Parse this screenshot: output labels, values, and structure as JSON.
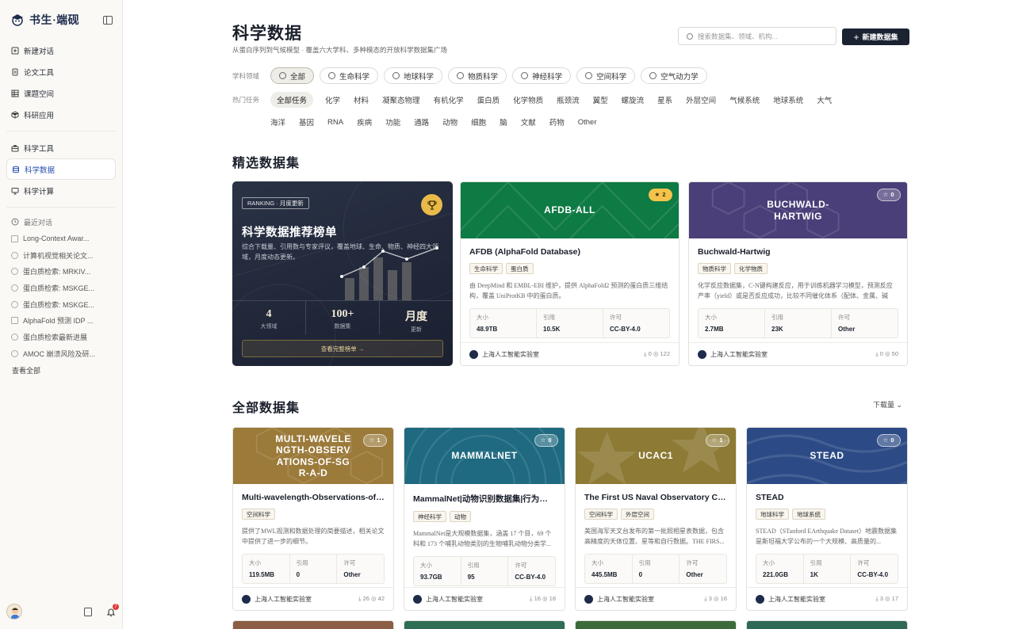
{
  "brand": {
    "name": "书生·端砚"
  },
  "sidebar": {
    "main_items": [
      {
        "label": "新建对话",
        "icon": "plus-square-icon"
      },
      {
        "label": "论文工具",
        "icon": "document-icon"
      },
      {
        "label": "课题空间",
        "icon": "grid-icon"
      },
      {
        "label": "科研应用",
        "icon": "cube-icon"
      }
    ],
    "tool_items": [
      {
        "label": "科学工具",
        "icon": "toolbox-icon"
      },
      {
        "label": "科学数据",
        "icon": "database-icon",
        "active": true
      },
      {
        "label": "科学计算",
        "icon": "monitor-icon"
      }
    ],
    "recent_heading": "最近对话",
    "recent": [
      {
        "label": "Long-Context Awar...",
        "icon": "doc"
      },
      {
        "label": "计算机视觉相关论文...",
        "icon": "cube"
      },
      {
        "label": "蛋白质检索: MRKIV...",
        "icon": "cube"
      },
      {
        "label": "蛋白质检索: MSKGE...",
        "icon": "cube"
      },
      {
        "label": "蛋白质检索: MSKGE...",
        "icon": "cube"
      },
      {
        "label": "AlphaFold 预测 IDP ...",
        "icon": "doc"
      },
      {
        "label": "蛋白质检索最新进展",
        "icon": "cube"
      },
      {
        "label": "AMOC 崩溃风险及研...",
        "icon": "cube"
      }
    ],
    "view_all": "查看全部",
    "notif_count": "7"
  },
  "header": {
    "title": "科学数据",
    "subtitle": "从蛋白序列到气候模型 · 覆盖六大学科、多种模态的开放科学数据集广场",
    "search_placeholder": "搜索数据集、领域、机构...",
    "new_button": "新建数据集"
  },
  "filters": {
    "domain_label": "学科领域",
    "domains": [
      {
        "label": "全部",
        "active": true
      },
      {
        "label": "生命科学"
      },
      {
        "label": "地球科学"
      },
      {
        "label": "物质科学"
      },
      {
        "label": "神经科学"
      },
      {
        "label": "空间科学"
      },
      {
        "label": "空气动力学"
      }
    ],
    "task_label": "热门任务",
    "tasks_row1": [
      "全部任务",
      "化学",
      "材料",
      "凝聚态物理",
      "有机化学",
      "蛋白质",
      "化学物质",
      "瓶颈流",
      "翼型",
      "螺旋流",
      "星系",
      "外层空间",
      "气候系统",
      "地球系统",
      "大气"
    ],
    "tasks_row2": [
      "海洋",
      "基因",
      "RNA",
      "疾病",
      "功能",
      "通路",
      "动物",
      "细胞",
      "脑",
      "文献",
      "药物",
      "Other"
    ]
  },
  "featured": {
    "heading": "精选数据集",
    "ranking": {
      "badge": "RANKING · 月度更新",
      "title": "科学数据推荐榜单",
      "desc": "综合下载量、引用数与专家评议，覆盖地球、生命、物质、神经四大领域，月度动态更新。",
      "stats": [
        {
          "value": "4",
          "label": "大领域"
        },
        {
          "value": "100+",
          "label": "数据集"
        },
        {
          "value": "月度",
          "label": "更新"
        }
      ],
      "button": "查看完整榜单 →"
    },
    "cards": [
      {
        "banner": "AFDB-ALL",
        "color": "#0e7a44",
        "star": "★ 2",
        "gold": true,
        "title": "AFDB (AlphaFold Database)",
        "tags": [
          "生命科学",
          "蛋白质"
        ],
        "desc": "由 DeepMind 和 EMBL-EBI 维护，提供 AlphaFold2 预测的蛋白质三维结构，覆盖 UniProtKB 中的蛋白质。",
        "size_label": "大小",
        "size": "48.9TB",
        "cite_label": "引用",
        "cite": "10.5K",
        "lic_label": "许可",
        "lic": "CC-BY-4.0",
        "org": "上海人工智能实验室",
        "downloads": "0",
        "views": "122"
      },
      {
        "banner": "BUCHWALD-HARTWIG",
        "color": "#4a3f78",
        "star": "☆ 0",
        "gold": false,
        "title": "Buchwald-Hartwig",
        "tags": [
          "物质科学",
          "化学物质"
        ],
        "desc": "化学反应数据集，C-N键构建反应，用于训练机器学习模型，预测反应产率（yield）或是否反应成功，比较不同催化体系（配体、金属、碱等...",
        "size_label": "大小",
        "size": "2.7MB",
        "cite_label": "引用",
        "cite": "23K",
        "lic_label": "许可",
        "lic": "Other",
        "org": "上海人工智能实验室",
        "downloads": "0",
        "views": "50"
      }
    ]
  },
  "all": {
    "heading": "全部数据集",
    "sort": "下载量 ⌄",
    "cards": [
      {
        "banner": "MULTI-WAVELENGTH-OBSERVATIONS-OF-SGR-A-D",
        "banner_lines": "MULTI-WAVELE NGTH-OBSERV ATIONS-OF-SG R-A-D",
        "color": "#9b7a3a",
        "star": "☆ 1",
        "title": "Multi-wavelength-Observations-of-Sgr-A-D",
        "tags": [
          "空间科学"
        ],
        "desc": "提供了MWL观测和数据处理的简要描述，相关论文中提供了进一步的细节。",
        "size_label": "大小",
        "size": "119.5MB",
        "cite_label": "引用",
        "cite": "0",
        "lic_label": "许可",
        "lic": "Other",
        "org": "上海人工智能实验室",
        "downloads": "26",
        "views": "42"
      },
      {
        "banner": "MAMMALNET",
        "color": "#1f6a80",
        "star": "☆ 0",
        "title": "MammalNet|动物识别数据集|行为识别",
        "tags": [
          "神经科学",
          "动物"
        ],
        "desc": "MammalNet是大规模数据集，涵盖 17 个目，69 个科和 173 个哺乳动物类别的生物哺乳动物分类学...",
        "size_label": "大小",
        "size": "93.7GB",
        "cite_label": "引用",
        "cite": "95",
        "lic_label": "许可",
        "lic": "CC-BY-4.0",
        "org": "上海人工智能实验室",
        "downloads": "16",
        "views": "18"
      },
      {
        "banner": "UCAC1",
        "color": "#8c7a35",
        "star": "☆ 1",
        "title": "The First US Naval Observatory CCD",
        "tags": [
          "空间科学",
          "外层空间"
        ],
        "desc": "美国海军天文台发布的第一批照相星表数据，包含高精度的天体位置、星等和自行数据。THE FIRS...",
        "size_label": "大小",
        "size": "445.5MB",
        "cite_label": "引用",
        "cite": "0",
        "lic_label": "许可",
        "lic": "Other",
        "org": "上海人工智能实验室",
        "downloads": "3",
        "views": "16"
      },
      {
        "banner": "STEAD",
        "color": "#2c4b86",
        "star": "☆ 0",
        "title": "STEAD",
        "tags": [
          "地球科学",
          "地球系统"
        ],
        "desc": "STEAD（STanford EArthquake Dataset）地震数据集是斯坦福大学公布的一个大规模、高质量的...",
        "size_label": "大小",
        "size": "221.0GB",
        "cite_label": "引用",
        "cite": "1K",
        "lic_label": "许可",
        "lic": "CC-BY-4.0",
        "org": "上海人工智能实验室",
        "downloads": "3",
        "views": "17"
      }
    ],
    "next_row_colors": [
      "#8a5d44",
      "#2f6e54",
      "#3b6b3a",
      "#2e6a55"
    ]
  }
}
